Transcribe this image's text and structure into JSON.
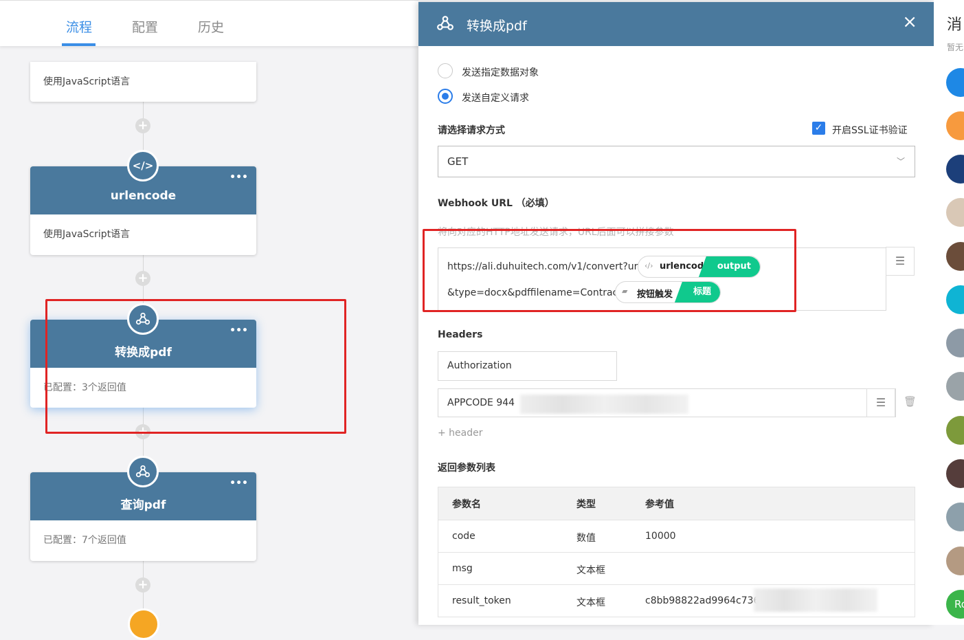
{
  "tabs": [
    "流程",
    "配置",
    "历史"
  ],
  "flow": {
    "card0_body": "使用JavaScript语言",
    "card1_title": "urlencode",
    "card1_body": "使用JavaScript语言",
    "card2_title": "转换成pdf",
    "card2_body": "已配置：3个返回值",
    "card3_title": "查询pdf",
    "card3_body": "已配置：7个返回值",
    "more": "•••",
    "plus": "+"
  },
  "drawer": {
    "title": "转换成pdf",
    "close": "×",
    "radio1": "发送指定数据对象",
    "radio2": "发送自定义请求",
    "method_label": "请选择请求方式",
    "ssl_label": "开启SSL证书验证",
    "method_value": "GET",
    "webhook_label": "Webhook URL （必填）",
    "webhook_hint": "将向对应的HTTP地址发送请求，URL后面可以拼接参数",
    "url_part1": "https://ali.duhuitech.com/v1/convert?url=",
    "pill1_label": "urlencode",
    "pill1_tag": "output",
    "url_part2": "&type=docx&pdffilename=Contract-",
    "pill2_label": "按钮触发",
    "pill2_tag": "标题",
    "headers_label": "Headers",
    "header_key": "Authorization",
    "header_value": "APPCODE 944",
    "add_header": "+ header",
    "return_label": "返回参数列表",
    "table": {
      "columns": [
        "参数名",
        "类型",
        "参考值"
      ],
      "rows": [
        [
          "code",
          "数值",
          "10000"
        ],
        [
          "msg",
          "文本框",
          ""
        ],
        [
          "result_token",
          "文本框",
          "c8bb98822ad9964c736"
        ]
      ]
    }
  },
  "far_right": {
    "title": "消",
    "subtitle": "暂无",
    "avatar_text": "Ro"
  },
  "colors": {
    "accent": "#3a8ee6",
    "node": "#4a799d",
    "green": "#10c98d",
    "red_annotation": "#e02424"
  }
}
